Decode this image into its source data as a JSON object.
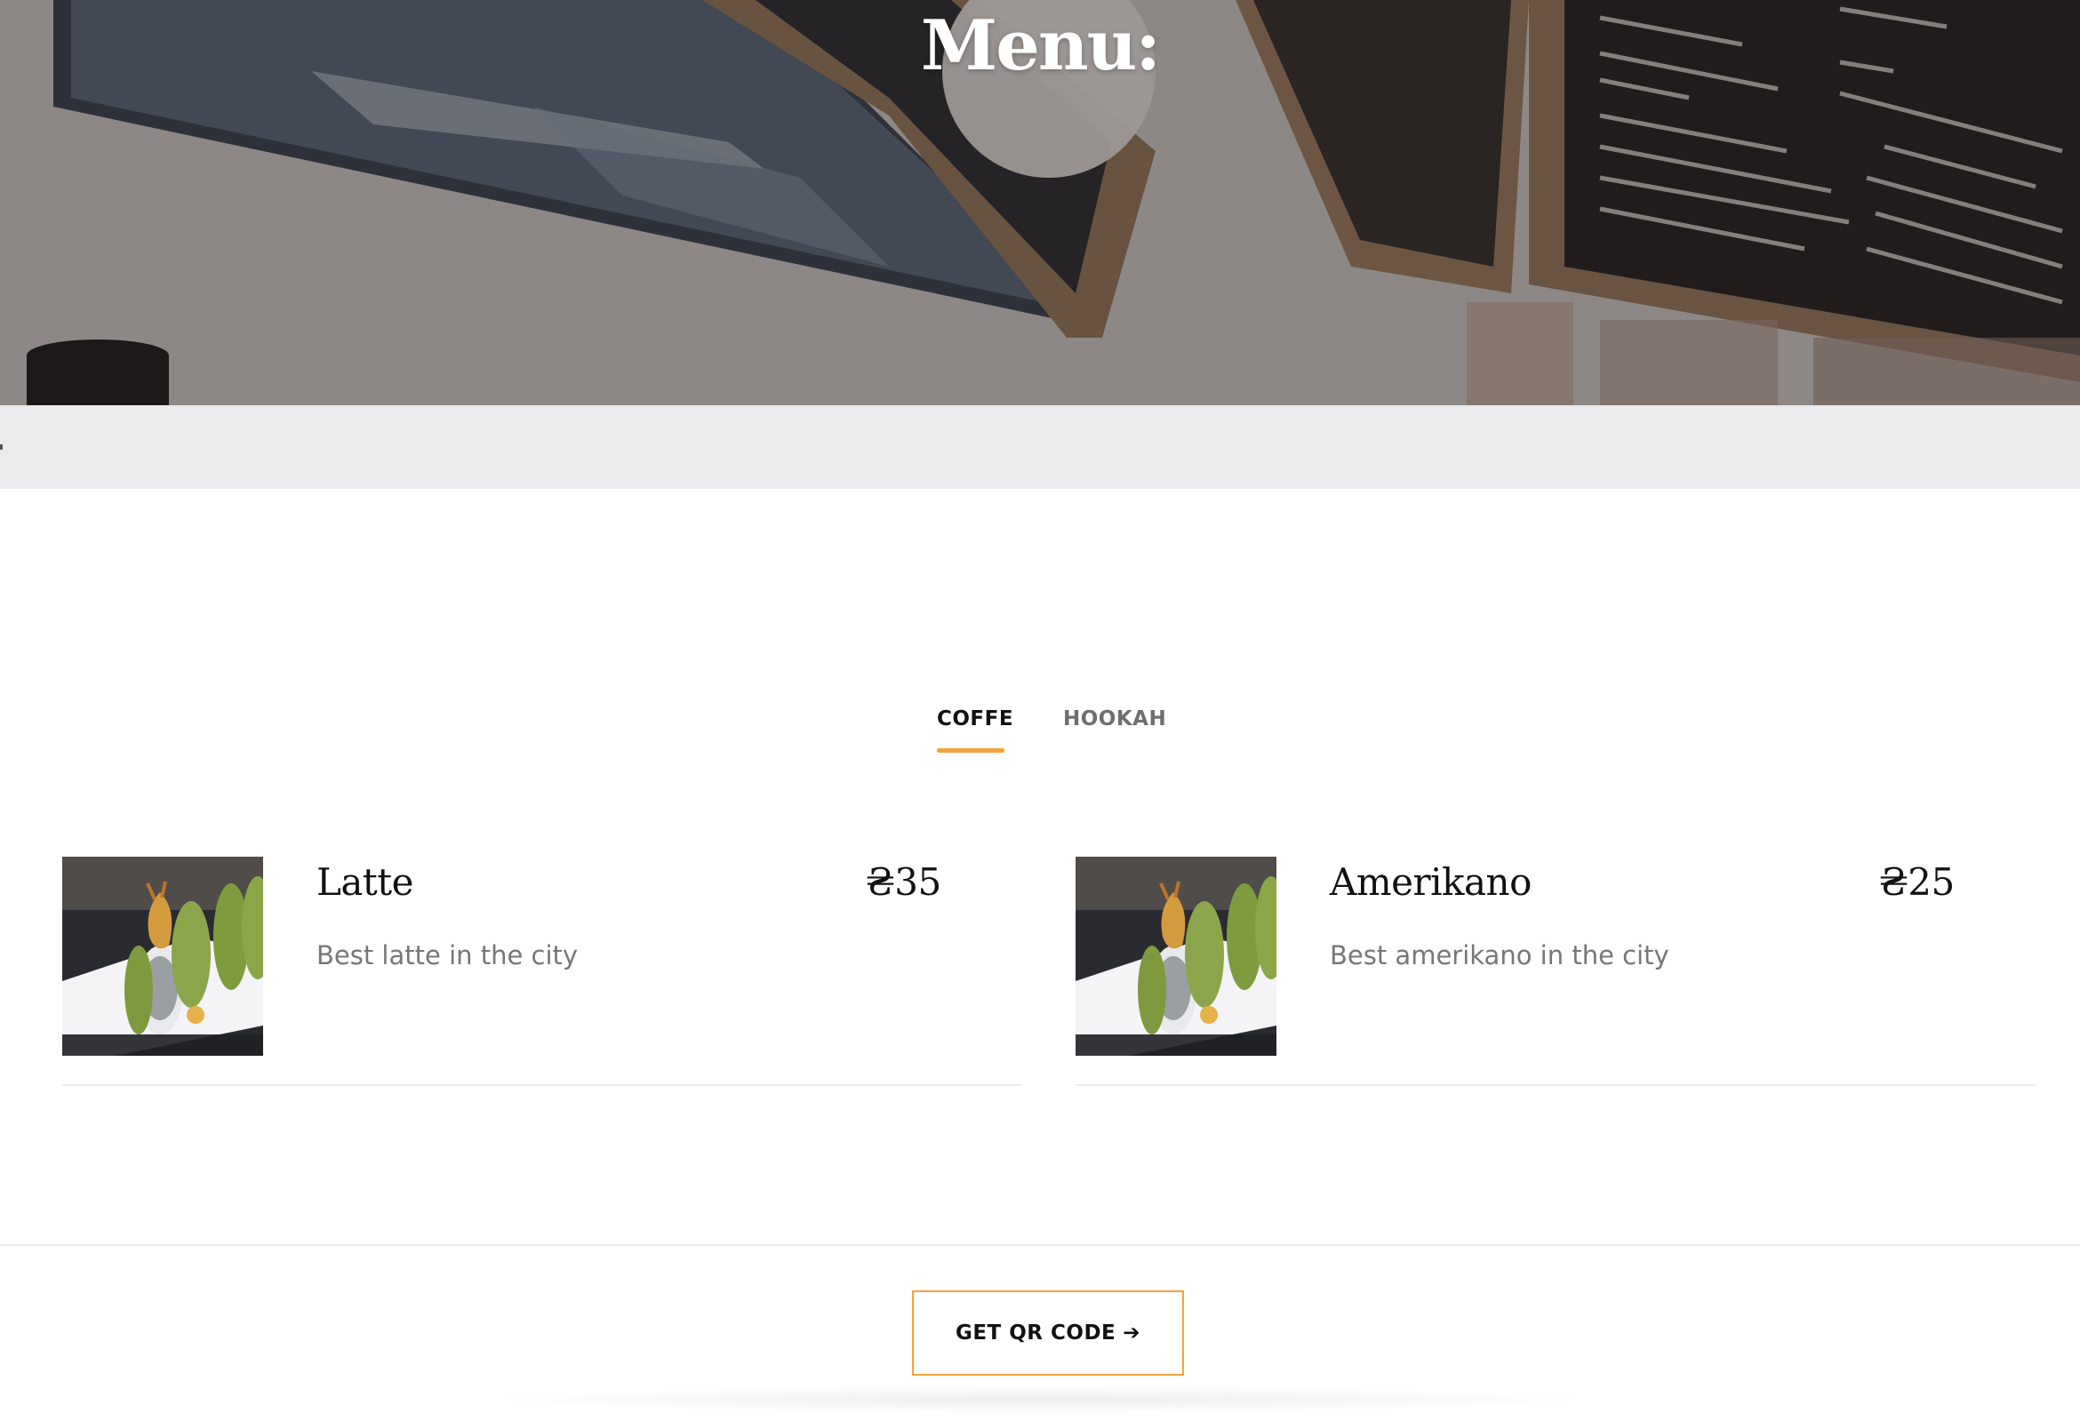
{
  "hero": {
    "title": "Menu:"
  },
  "tabs": [
    {
      "label": "COFFE",
      "active": true
    },
    {
      "label": "HOOKAH",
      "active": false
    }
  ],
  "colors": {
    "accent": "#f2a33a",
    "text_dark": "#111111",
    "text_muted": "#777777",
    "strip_bg": "#ebebee"
  },
  "menu": {
    "items": [
      {
        "name": "Latte",
        "price": "₴35",
        "description": "Best latte in the city",
        "image": "sushi-roll-photo"
      },
      {
        "name": "Amerikano",
        "price": "₴25",
        "description": "Best amerikano in the city",
        "image": "sushi-roll-photo"
      }
    ]
  },
  "footer": {
    "qr_button_label": "GET QR CODE",
    "qr_button_icon": "arrow-right-icon",
    "qr_button_arrow": "➔"
  }
}
